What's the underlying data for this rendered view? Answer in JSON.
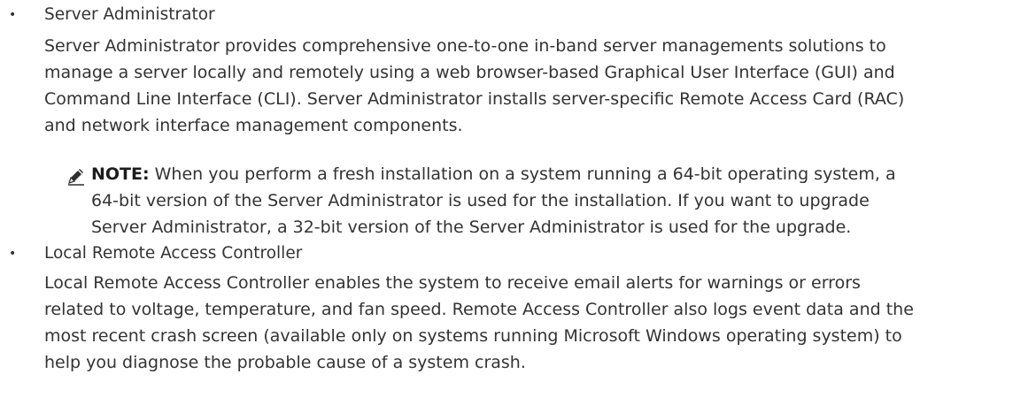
{
  "items": [
    {
      "title": "Server Administrator",
      "lines": [
        "Server Administrator provides comprehensive one-to-one in-band server managements solutions to",
        "manage a server locally and remotely using a web browser-based Graphical User Interface (GUI) and",
        "Command Line Interface (CLI). Server Administrator installs server-specific Remote Access Card (RAC)",
        "and network interface management components."
      ]
    },
    {
      "title": "Local Remote Access Controller",
      "lines": [
        "Local Remote Access Controller enables the system to receive email alerts for warnings or errors",
        "related to voltage, temperature, and fan speed. Remote Access Controller also logs event data and the",
        "most recent crash screen (available only on systems running Microsoft Windows operating system) to",
        "help you diagnose the probable cause of a system crash."
      ]
    }
  ],
  "note": {
    "icon": "pencil-icon",
    "label": "NOTE:",
    "first_line": " When you perform a fresh installation on a system running a 64-bit operating system, a",
    "lines": [
      "64-bit version of the Server Administrator is used for the installation. If you want to upgrade",
      "Server Administrator, a 32-bit version of the Server Administrator is used for the upgrade."
    ]
  },
  "bullet": "•"
}
